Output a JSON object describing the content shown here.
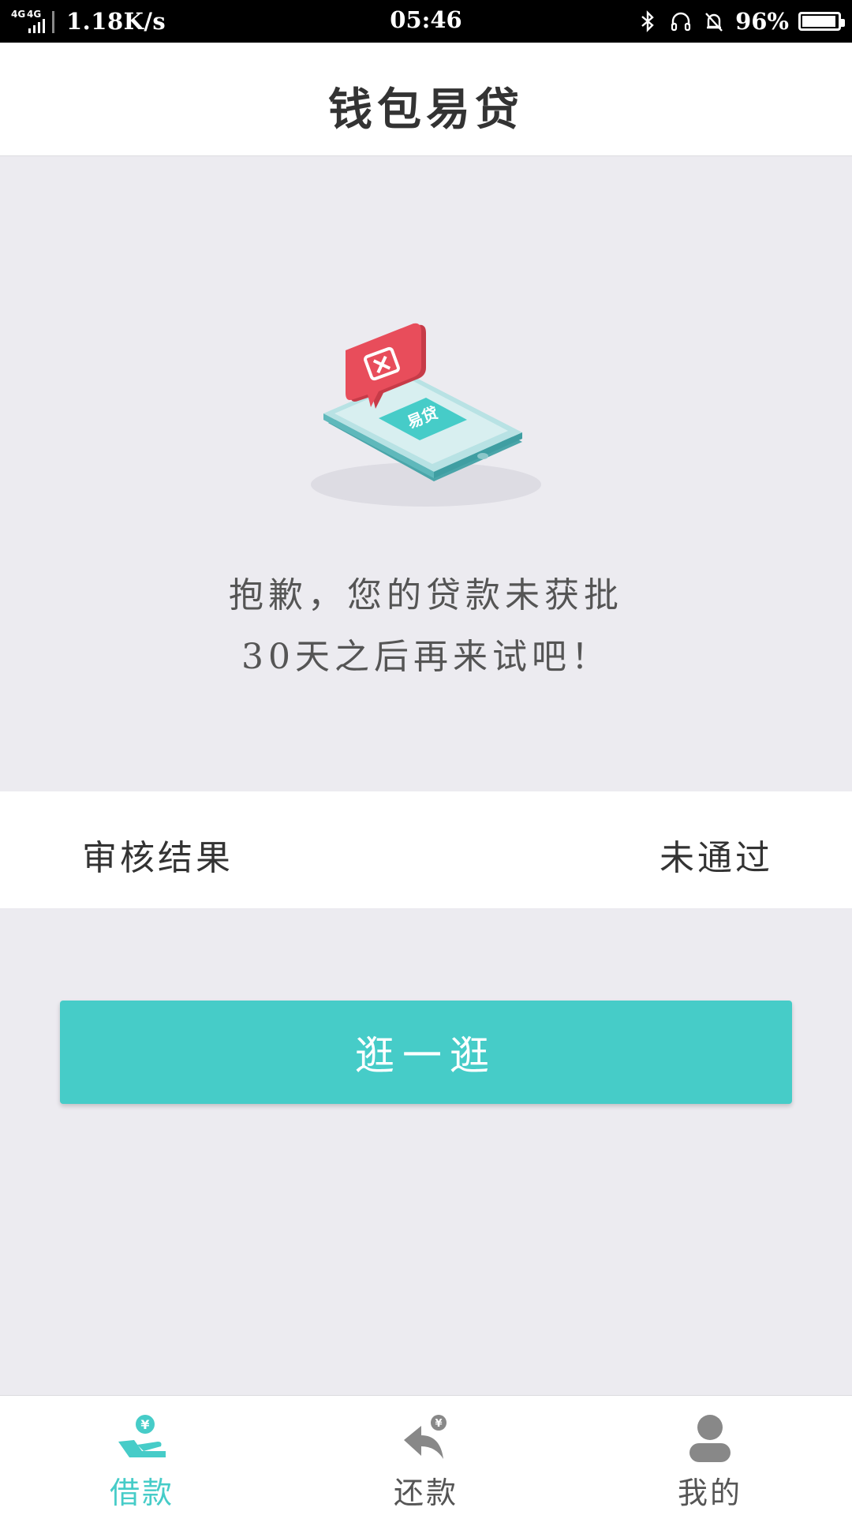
{
  "status_bar": {
    "network": "4G 4G",
    "speed": "1.18K/s",
    "time": "05:46",
    "battery": "96%",
    "battery_level": 0.96,
    "icons": [
      "bluetooth-icon",
      "headphone-icon",
      "bell-muted-icon",
      "battery-icon"
    ]
  },
  "header": {
    "title": "钱包易贷"
  },
  "illustration": {
    "badge_text": "易贷",
    "icon": "phone-rejected-illustration"
  },
  "message": {
    "line1": "抱歉，您的贷款未获批",
    "line2": "30天之后再来试吧！"
  },
  "result": {
    "label": "审核结果",
    "value": "未通过"
  },
  "button": {
    "label": "逛一逛"
  },
  "tabs": [
    {
      "label": "借款",
      "icon": "borrow-icon",
      "active": true
    },
    {
      "label": "还款",
      "icon": "repay-icon",
      "active": false
    },
    {
      "label": "我的",
      "icon": "profile-icon",
      "active": false
    }
  ],
  "colors": {
    "accent": "#46ccc8",
    "background": "#ecebf0",
    "inactive_icon": "#888888",
    "alert_red": "#e84d5b"
  }
}
